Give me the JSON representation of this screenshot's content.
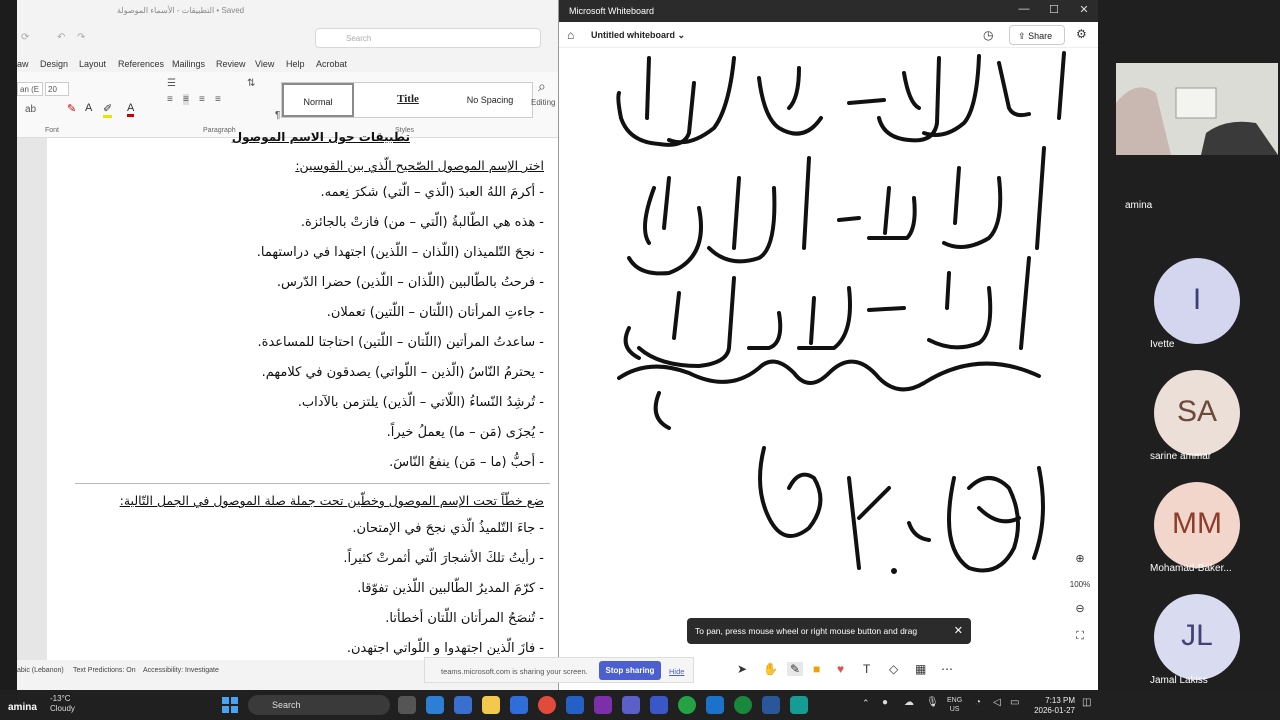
{
  "word": {
    "title": "التطبيقات - الأسماء الموصولة • Saved",
    "search_placeholder": "Search",
    "tabs": [
      "aw",
      "Design",
      "Layout",
      "References",
      "Mailings",
      "Review",
      "View",
      "Help",
      "Acrobat"
    ],
    "font_name": "an (E",
    "font_size": "20",
    "styles": [
      "Normal",
      "Title",
      "No Spacing"
    ],
    "group_labels": {
      "font": "Font",
      "paragraph": "Paragraph",
      "styles": "Styles"
    },
    "editing_label": "Editing",
    "doc": {
      "partial_heading": "تطبيقات حول الاسم الموصول",
      "section1_heading": "اختر الإسم الموصول الصّحيح الّذي بين القوسين:",
      "section1_items": [
        "- أكرمَ اللهُ العبدَ (الّذي – الّتي) شكرَ نِعمه.",
        "- هذه هي الطّالبةُ (الّتي – من) فازتْ بالجائزة.",
        "- نجحَ التّلميذان (اللّذان – اللّذين) اجتهدا في دراستهما.",
        "- فرحتُ بالطّالبين (اللّذان – اللّذين) حضرا الدّرس.",
        "- جاءتِ المرأتان (اللّتان – اللّتين) تعملان.",
        "- ساعدتُ المرأتين (اللّتان – اللّتين) احتاجتا للمساعدة.",
        "- يحترمُ النّاسُ (الّذين – اللّواتي) يصدقون في كلامهم.",
        "- تُرشِدُ النّساءُ (اللّاتي – الّذين) يلتزمن بالآداب.",
        "- يُجزَى (مَن – ما) يعملُ خيراً.",
        "- أحبُّ (ما – مَن) ينفعُ النّاسَ."
      ],
      "section2_heading": "ضع خطّاً تحت الإسم الموصول وخطّين تحت جملة صلة الموصول في الجمل التّالية:",
      "section2_items": [
        "- جاءَ التّلميذُ الّذي نجحَ في الإمتحان.",
        "- رأيتُ تلكَ الأشجارَ الّتي أثمرتْ كثيراً.",
        "- كرّمَ المديرُ الطّالبين اللّذين تفوّقا.",
        "- تُنصَحُ المرأتان اللّتان أخطأتا.",
        "- فازَ الّذين اجتهدوا و اللّواتي اجتهدن."
      ]
    },
    "status": {
      "lang": "abic (Lebanon)",
      "predictions": "Text Predictions: On",
      "accessibility": "Accessibility: Investigate"
    }
  },
  "whiteboard": {
    "app_title": "Microsoft Whiteboard",
    "board_name": "Untitled whiteboard",
    "share_label": "Share",
    "zoom_level": "100%",
    "tip": "To pan, press mouse wheel or right mouse button and drag",
    "colors": {
      "ink": "#111111"
    }
  },
  "sharebar": {
    "message": "teams.microsoft.com is sharing your screen.",
    "stop_label": "Stop sharing",
    "hide_label": "Hide"
  },
  "participants": {
    "camera_name": "amina",
    "list": [
      {
        "initials": "I",
        "name": "Ivette",
        "bg": "#d4d6ef",
        "fg": "#3a3f7a"
      },
      {
        "initials": "SA",
        "name": "sarine ammar",
        "bg": "#ecdfd8",
        "fg": "#6b4a3a"
      },
      {
        "initials": "MM",
        "name": "Mohamad-Baker...",
        "bg": "#f2d6cc",
        "fg": "#8b3d2a"
      },
      {
        "initials": "JL",
        "name": "Jamal Lakiss",
        "bg": "#d9dcf0",
        "fg": "#3f4475"
      }
    ]
  },
  "taskbar": {
    "user": "amina",
    "temp": "-13°C",
    "weather": "Cloudy",
    "search_label": "Search",
    "lang_top": "ENG",
    "lang_bottom": "US",
    "time": "7:13 PM",
    "date": "2026-01-27"
  }
}
